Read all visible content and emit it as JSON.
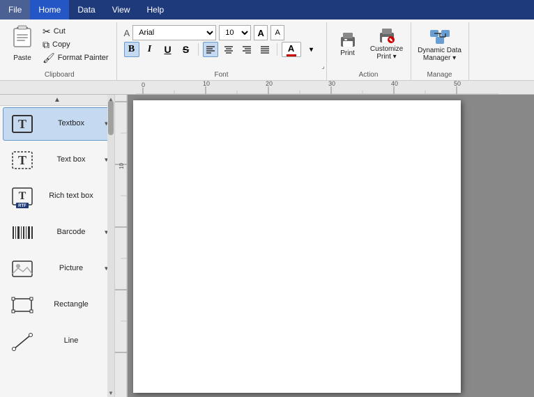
{
  "menubar": {
    "items": [
      {
        "label": "File",
        "active": false
      },
      {
        "label": "Home",
        "active": true
      },
      {
        "label": "Data",
        "active": false
      },
      {
        "label": "View",
        "active": false
      },
      {
        "label": "Help",
        "active": false
      }
    ]
  },
  "clipboard": {
    "group_label": "Clipboard",
    "paste_label": "Paste",
    "cut_label": "Cut",
    "copy_label": "Copy",
    "format_painter_label": "Format Painter"
  },
  "font": {
    "group_label": "Font",
    "font_name": "Arial",
    "font_size": "10",
    "bold": "B",
    "italic": "I",
    "underline": "U",
    "strikethrough": "S",
    "font_color_label": "A",
    "grow_label": "A",
    "shrink_label": "A",
    "expand_icon": "⌟"
  },
  "alignment": {
    "align_left": "≡",
    "align_center": "≡",
    "align_right": "≡",
    "align_justify": "≡"
  },
  "action": {
    "group_label": "Action",
    "print_label": "Print",
    "customize_print_label": "Customize Print ▾",
    "dynamic_data_label": "Dynamic Data Manager ▾"
  },
  "manage": {
    "group_label": "Manage"
  },
  "tools": [
    {
      "id": "textbox",
      "label": "Textbox",
      "icon": "T",
      "has_dropdown": true,
      "selected": true
    },
    {
      "id": "textbox2",
      "label": "Text box",
      "icon": "T_outline",
      "has_dropdown": true,
      "selected": false
    },
    {
      "id": "rich_text_box",
      "label": "Rich text box",
      "icon": "RTF",
      "has_dropdown": false,
      "selected": false
    },
    {
      "id": "barcode",
      "label": "Barcode",
      "icon": "barcode",
      "has_dropdown": true,
      "selected": false
    },
    {
      "id": "picture",
      "label": "Picture",
      "icon": "picture",
      "has_dropdown": true,
      "selected": false
    },
    {
      "id": "rectangle",
      "label": "Rectangle",
      "icon": "rectangle",
      "has_dropdown": false,
      "selected": false
    },
    {
      "id": "line",
      "label": "Line",
      "icon": "line",
      "has_dropdown": false,
      "selected": false
    }
  ],
  "ruler": {
    "marks": [
      "0",
      "10",
      "20",
      "30",
      "40",
      "50"
    ]
  }
}
